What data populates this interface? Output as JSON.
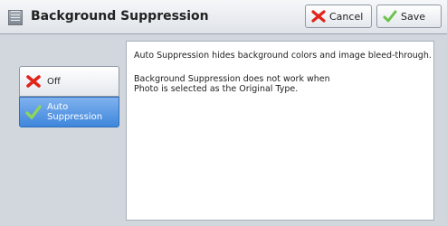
{
  "window": {
    "title": "Background Suppression",
    "icon": "menu-icon"
  },
  "toolbar": {
    "cancel_label": "Cancel",
    "save_label": "Save"
  },
  "options": [
    {
      "label": "Off",
      "selected": false,
      "icon": "x-icon"
    },
    {
      "label_line1": "Auto",
      "label_line2": "Suppression",
      "selected": true,
      "icon": "check-icon"
    }
  ],
  "info": {
    "line1": "Auto Suppression hides background colors and image bleed-through.",
    "line2": "Background Suppression does not work when",
    "line3": "Photo is selected as the Original Type."
  },
  "colors": {
    "selected": "#3f86dc",
    "x_red": "#e2231a",
    "check_green": "#6cc24a"
  }
}
